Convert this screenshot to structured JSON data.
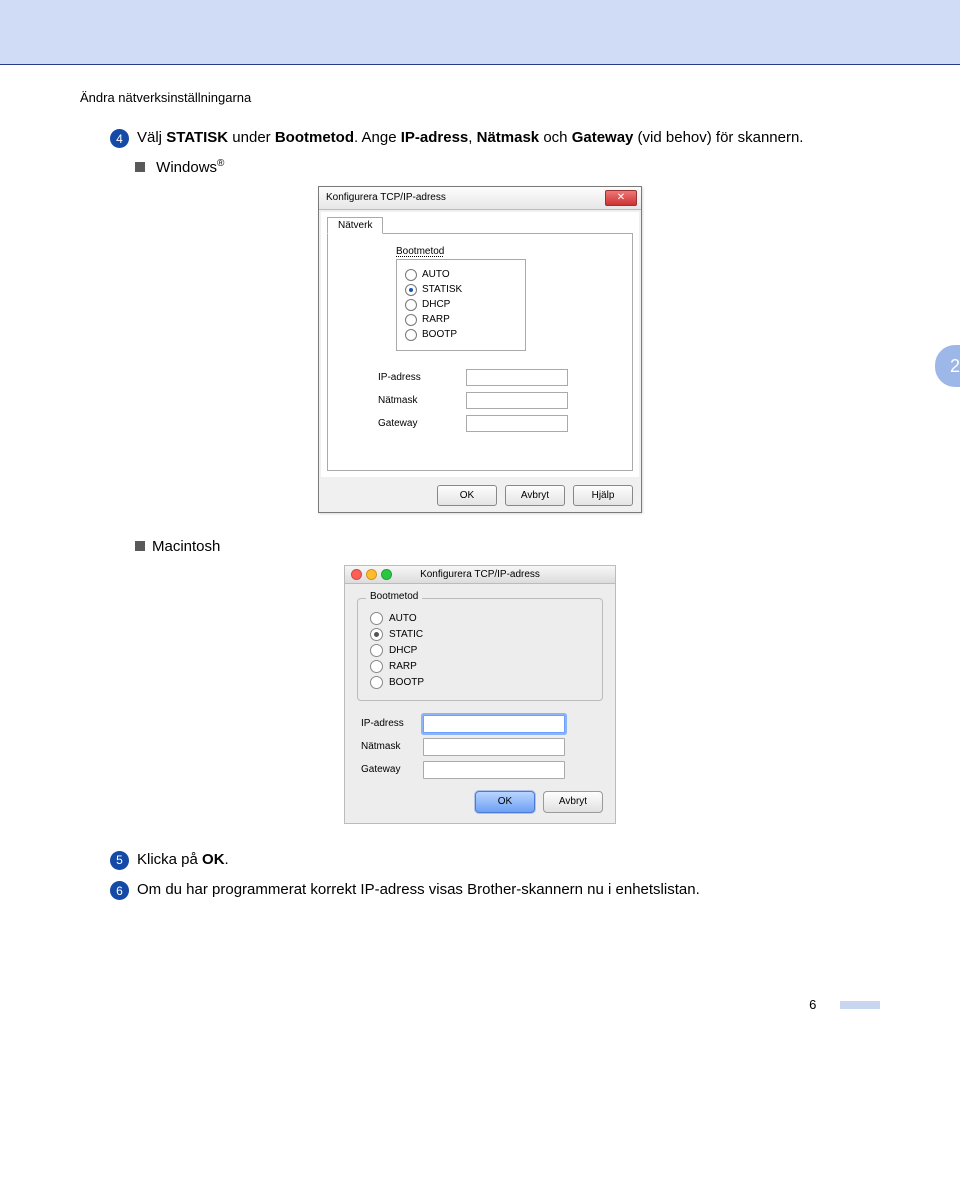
{
  "breadcrumb": "Ändra nätverksinställningarna",
  "chapter_tab": "2",
  "steps": {
    "4": {
      "num": "4",
      "text_pre": "Välj ",
      "bold1": "STATISK",
      "mid1": " under ",
      "bold2": "Bootmetod",
      "mid2": ". Ange ",
      "bold3": "IP-adress",
      "mid3": ", ",
      "bold4": "Nätmask",
      "mid4": " och ",
      "bold5": "Gateway",
      "mid5": " (vid behov) för skannern."
    },
    "5": {
      "num": "5",
      "text_pre": "Klicka på ",
      "bold1": "OK",
      "tail": "."
    },
    "6": {
      "num": "6",
      "text": "Om du har programmerat korrekt IP-adress visas Brother-skannern nu i enhetslistan."
    }
  },
  "os_labels": {
    "windows": "Windows",
    "macintosh": "Macintosh"
  },
  "win": {
    "title": "Konfigurera TCP/IP-adress",
    "tab": "Nätverk",
    "boot_label": "Bootmetod",
    "radios": [
      "AUTO",
      "STATISK",
      "DHCP",
      "RARP",
      "BOOTP"
    ],
    "selected": "STATISK",
    "fields": {
      "ip": "IP-adress",
      "mask": "Nätmask",
      "gw": "Gateway"
    },
    "buttons": {
      "ok": "OK",
      "cancel": "Avbryt",
      "help": "Hjälp"
    }
  },
  "mac": {
    "title": "Konfigurera TCP/IP-adress",
    "boot_label": "Bootmetod",
    "radios": [
      "AUTO",
      "STATIC",
      "DHCP",
      "RARP",
      "BOOTP"
    ],
    "selected": "STATIC",
    "fields": {
      "ip": "IP-adress",
      "mask": "Nätmask",
      "gw": "Gateway"
    },
    "buttons": {
      "ok": "OK",
      "cancel": "Avbryt"
    }
  },
  "page_number": "6"
}
